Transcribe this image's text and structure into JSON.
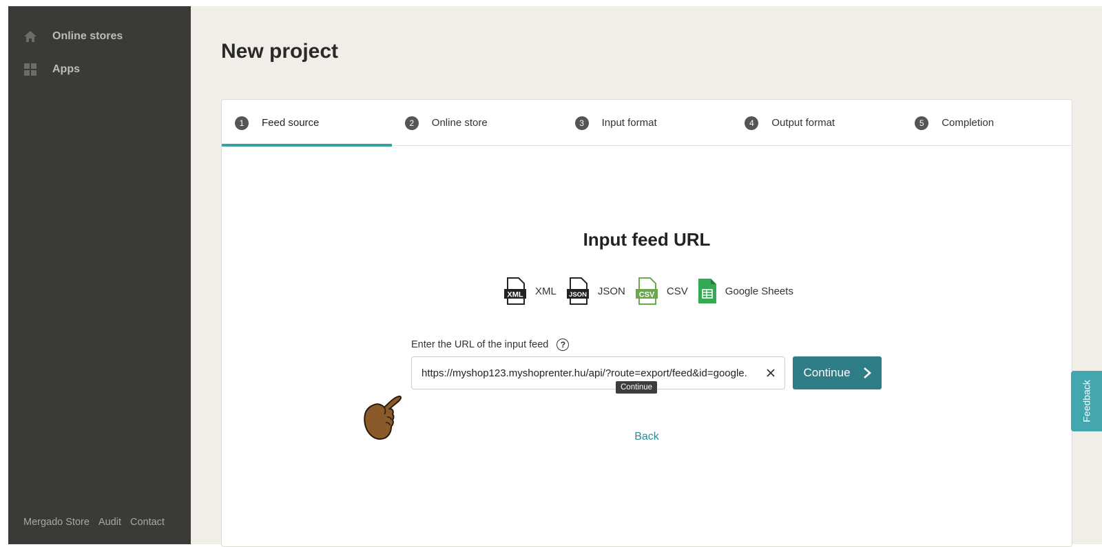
{
  "sidebar": {
    "items": [
      {
        "label": "Online stores",
        "icon": "home-icon"
      },
      {
        "label": "Apps",
        "icon": "apps-grid-icon"
      }
    ],
    "footer_links": [
      "Mergado Store",
      "Audit",
      "Contact"
    ]
  },
  "page": {
    "title": "New project"
  },
  "stepper": {
    "steps": [
      {
        "number": "1",
        "label": "Feed source",
        "active": true
      },
      {
        "number": "2",
        "label": "Online store",
        "active": false
      },
      {
        "number": "3",
        "label": "Input format",
        "active": false
      },
      {
        "number": "4",
        "label": "Output format",
        "active": false
      },
      {
        "number": "5",
        "label": "Completion",
        "active": false
      }
    ]
  },
  "form": {
    "heading": "Input feed URL",
    "formats": [
      {
        "label": "XML",
        "icon": "xml-file-icon"
      },
      {
        "label": "JSON",
        "icon": "json-file-icon"
      },
      {
        "label": "CSV",
        "icon": "csv-file-icon"
      },
      {
        "label": "Google Sheets",
        "icon": "google-sheets-icon"
      }
    ],
    "field_label": "Enter the URL of the input feed",
    "help_glyph": "?",
    "url_value": "https://myshop123.myshoprenter.hu/api/?route=export/feed&id=google.",
    "continue_label": "Continue",
    "tooltip": "Continue",
    "back_label": "Back"
  },
  "feedback": {
    "label": "Feedback"
  },
  "colors": {
    "sidebar_bg": "#3a3a36",
    "page_bg": "#f1eee8",
    "accent": "#3aa0a6",
    "button": "#2f7d86",
    "feedback_tab": "#44a7b0"
  }
}
